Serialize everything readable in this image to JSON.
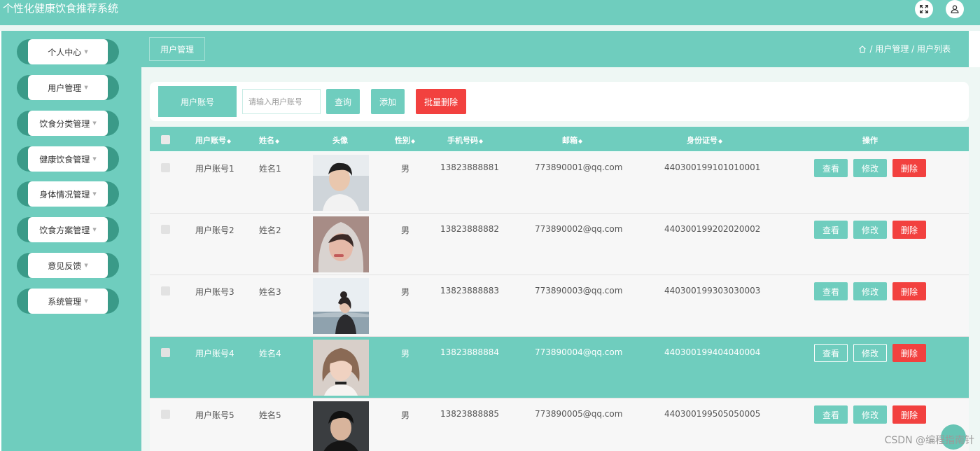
{
  "app": {
    "title": "个性化健康饮食推荐系统"
  },
  "topbar_icons": [
    "fullscreen-icon",
    "user-icon"
  ],
  "sidebar": {
    "items": [
      {
        "label": "个人中心"
      },
      {
        "label": "用户管理"
      },
      {
        "label": "饮食分类管理"
      },
      {
        "label": "健康饮食管理"
      },
      {
        "label": "身体情况管理"
      },
      {
        "label": "饮食方案管理"
      },
      {
        "label": "意见反馈"
      },
      {
        "label": "系统管理"
      }
    ]
  },
  "header": {
    "tag": "用户管理",
    "breadcrumb": "/ 用户管理 / 用户列表"
  },
  "search": {
    "label": "用户账号",
    "placeholder": "请输入用户账号",
    "query_button": "查询",
    "add_button": "添加",
    "batch_delete_button": "批量删除"
  },
  "table": {
    "columns": [
      "用户账号",
      "姓名",
      "头像",
      "性别",
      "手机号码",
      "邮箱",
      "身份证号",
      "操作"
    ],
    "actions": {
      "view": "查看",
      "edit": "修改",
      "delete": "删除"
    },
    "rows": [
      {
        "account": "用户账号1",
        "name": "姓名1",
        "gender": "男",
        "phone": "13823888881",
        "email": "773890001@qq.com",
        "idcard": "440300199101010001"
      },
      {
        "account": "用户账号2",
        "name": "姓名2",
        "gender": "男",
        "phone": "13823888882",
        "email": "773890002@qq.com",
        "idcard": "440300199202020002"
      },
      {
        "account": "用户账号3",
        "name": "姓名3",
        "gender": "男",
        "phone": "13823888883",
        "email": "773890003@qq.com",
        "idcard": "440300199303030003"
      },
      {
        "account": "用户账号4",
        "name": "姓名4",
        "gender": "男",
        "phone": "13823888884",
        "email": "773890004@qq.com",
        "idcard": "440300199404040004"
      },
      {
        "account": "用户账号5",
        "name": "姓名5",
        "gender": "男",
        "phone": "13823888885",
        "email": "773890005@qq.com",
        "idcard": "440300199505050005"
      }
    ]
  },
  "watermark": "CSDN @编程指南针",
  "colors": {
    "primary": "#6fcdbe",
    "danger": "#f2413f",
    "sidebar_pill": "#3a9a88"
  }
}
